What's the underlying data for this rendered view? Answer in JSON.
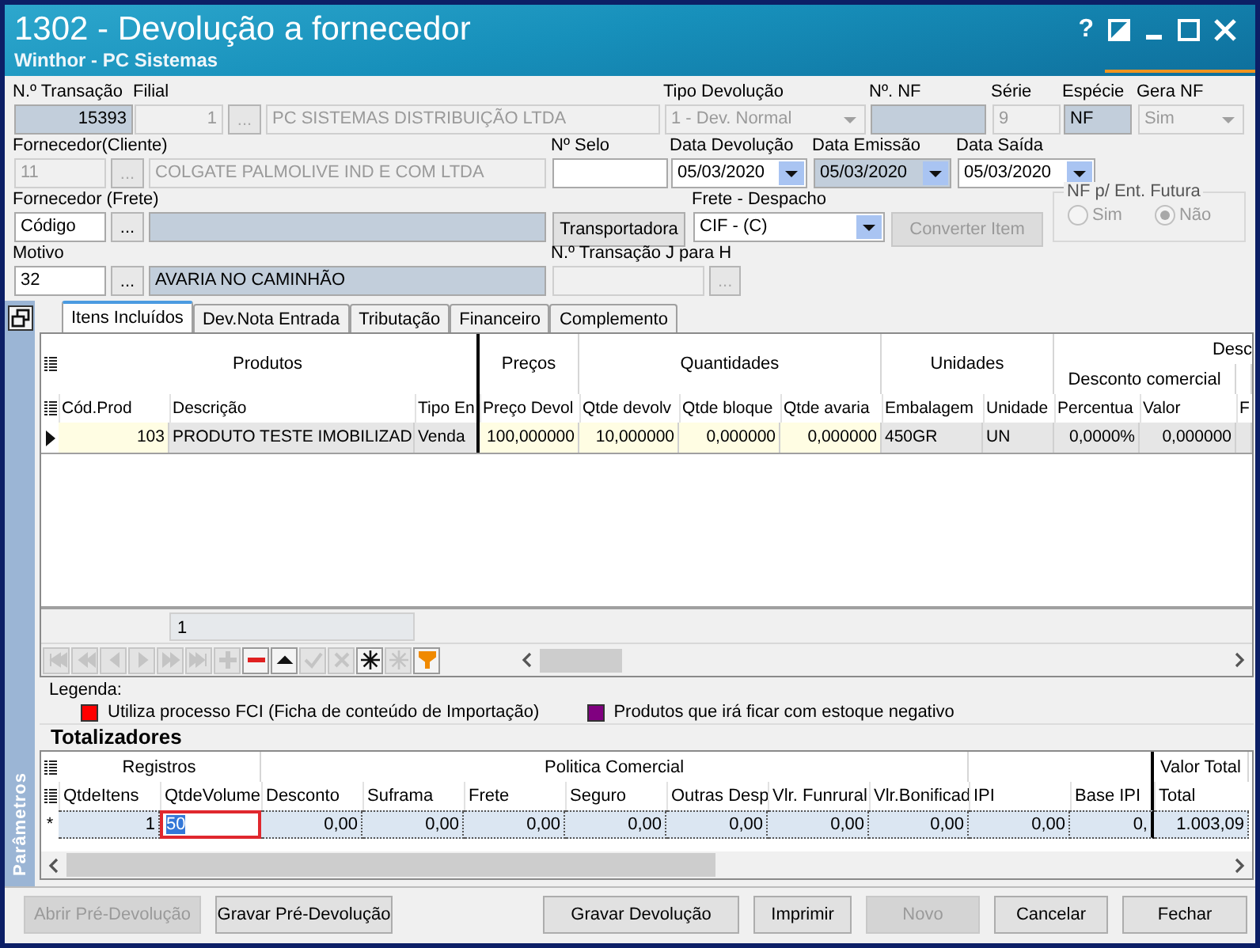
{
  "window": {
    "title": "1302 - Devolução a fornecedor",
    "subtitle": "Winthor - PC Sistemas",
    "help": "?"
  },
  "form": {
    "rows": [
      {
        "columns": [
          {
            "label": "N.º Transação",
            "controls": [
              {
                "kind": "number-field",
                "value": "15393",
                "readonly": true,
                "disabled": false
              }
            ]
          },
          {
            "label": "Filial",
            "controls": [
              {
                "kind": "number-field",
                "value": "1",
                "disabled": true
              },
              {
                "kind": "ellipsis",
                "label": "...",
                "disabled": true
              },
              {
                "kind": "field",
                "value": "PC SISTEMAS DISTRIBUIÇÃO LTDA",
                "disabled": true
              }
            ]
          },
          {
            "label": "Tipo Devolução",
            "controls": [
              {
                "kind": "combo",
                "value": "1 - Dev. Normal",
                "disabled": true
              }
            ]
          },
          {
            "label": "Nº. NF",
            "controls": [
              {
                "kind": "field",
                "readonly": true,
                "disabled": false
              }
            ]
          },
          {
            "label": "Série",
            "controls": [
              {
                "kind": "field",
                "value": "9",
                "disabled": true
              }
            ]
          },
          {
            "label": "Espécie",
            "controls": [
              {
                "kind": "field",
                "value": "NF",
                "readonly": true,
                "disabled": false
              }
            ]
          },
          {
            "label": "Gera NF",
            "controls": [
              {
                "kind": "combo",
                "value": "Sim",
                "disabled": true
              }
            ]
          }
        ]
      },
      {
        "columns": [
          {
            "label": "Fornecedor(Cliente)",
            "controls": [
              {
                "kind": "field",
                "value": "11",
                "disabled": true
              },
              {
                "kind": "ellipsis",
                "label": "...",
                "disabled": true
              },
              {
                "kind": "field",
                "value": "COLGATE PALMOLIVE IND E COM LTDA",
                "disabled": true
              }
            ]
          },
          {
            "label": "Nº Selo",
            "controls": [
              {
                "kind": "field",
                "readonly": false,
                "disabled": false
              }
            ]
          },
          {
            "label": "Data Devolução",
            "controls": [
              {
                "kind": "date",
                "value": "05/03/2020",
                "readonly": false,
                "disabled": false
              }
            ]
          },
          {
            "label": "Data Emissão",
            "controls": [
              {
                "kind": "date",
                "value": "05/03/2020",
                "readonly": true,
                "disabled": false
              }
            ]
          },
          {
            "label": "Data Saída",
            "controls": [
              {
                "kind": "date",
                "value": "05/03/2020",
                "readonly": false,
                "disabled": false
              }
            ]
          }
        ]
      },
      {
        "columns": [
          {
            "label": "Fornecedor (Frete)",
            "controls": [
              {
                "kind": "field",
                "value": "Código",
                "readonly": false,
                "disabled": false
              },
              {
                "kind": "ellipsis",
                "label": "...",
                "disabled": false
              },
              {
                "kind": "field",
                "readonly": true,
                "disabled": false
              }
            ]
          },
          {
            "controls": [
              {
                "kind": "button",
                "label": "Transportadora",
                "disabled": false
              }
            ]
          },
          {
            "label": "Frete - Despacho",
            "controls": [
              {
                "kind": "combo",
                "value": "CIF - (C)",
                "readonly": false,
                "disabled": false
              }
            ]
          },
          {
            "controls": [
              {
                "kind": "button",
                "label": "Converter Item",
                "disabled": true
              }
            ]
          },
          {
            "controls": [
              {
                "kind": "radio-group",
                "title": "NF p/ Ent. Futura",
                "disabled": true,
                "options": [
                  {
                    "label": "Sim",
                    "selected": false
                  },
                  {
                    "label": "Não",
                    "selected": true
                  }
                ]
              }
            ]
          }
        ]
      },
      {
        "columns": [
          {
            "label": "Motivo",
            "controls": [
              {
                "kind": "field",
                "value": "32",
                "readonly": false,
                "disabled": false
              },
              {
                "kind": "ellipsis",
                "label": "...",
                "disabled": false
              },
              {
                "kind": "field",
                "value": "AVARIA NO CAMINHÃO",
                "readonly": true,
                "disabled": false
              }
            ]
          },
          {
            "label": "N.º Transação J para H",
            "controls": [
              {
                "kind": "field",
                "disabled": true
              },
              {
                "kind": "ellipsis",
                "label": "...",
                "disabled": true
              }
            ]
          }
        ]
      }
    ]
  },
  "side_panel": {
    "title": "Parâmetros"
  },
  "tabs": [
    {
      "label": "Itens Incluídos",
      "selected": true
    },
    {
      "label": "Dev.Nota Entrada",
      "selected": false
    },
    {
      "label": "Tributação",
      "selected": false
    },
    {
      "label": "Financeiro",
      "selected": false
    },
    {
      "label": "Complemento",
      "selected": false
    }
  ],
  "items_grid": {
    "groups": [
      {
        "label": "Produtos",
        "columns": [
          "Cód.Prod",
          "Descrição",
          "Tipo En"
        ]
      },
      {
        "label": "Preços",
        "columns": [
          "Preço Devol"
        ]
      },
      {
        "label": "Quantidades",
        "columns": [
          "Qtde devolv",
          "Qtde bloque",
          "Qtde avaria"
        ]
      },
      {
        "label": "Unidades",
        "columns": [
          "Embalagem",
          "Unidade"
        ]
      },
      {
        "label": "Desc",
        "subgroups": [
          {
            "label": "Desconto comercial",
            "columns": [
              "Percentua",
              "Valor"
            ]
          },
          {
            "columns": [
              "F"
            ]
          }
        ]
      }
    ],
    "rows": [
      {
        "current": true,
        "cells": [
          "103",
          "PRODUTO TESTE IMOBILIZAD",
          "Venda",
          "100,000000",
          "10,000000",
          "0,000000",
          "0,000000",
          "450GR",
          "UN",
          "0,0000%",
          "0,000000"
        ]
      }
    ],
    "footer_total": "1"
  },
  "navigator": [
    {
      "kind": "first",
      "disabled": true
    },
    {
      "kind": "prior-page",
      "disabled": true
    },
    {
      "kind": "prior",
      "disabled": true
    },
    {
      "kind": "next",
      "disabled": true
    },
    {
      "kind": "next-page",
      "disabled": true
    },
    {
      "kind": "last",
      "disabled": true
    },
    {
      "kind": "insert",
      "disabled": true
    },
    {
      "kind": "delete",
      "disabled": false
    },
    {
      "kind": "up",
      "disabled": false
    },
    {
      "kind": "post",
      "disabled": true
    },
    {
      "kind": "cancel",
      "disabled": true
    },
    {
      "kind": "asterisk",
      "disabled": false
    },
    {
      "kind": "asterisk",
      "disabled": true
    },
    {
      "kind": "filter",
      "disabled": false
    }
  ],
  "legend": {
    "title": "Legenda:",
    "items": [
      {
        "label": "Utiliza processo FCI (Ficha de conteúdo de Importação)",
        "color": "#ff0000"
      },
      {
        "label": "Produtos que irá ficar com estoque negativo",
        "color": "#800080"
      }
    ]
  },
  "totals": {
    "title": "Totalizadores",
    "groups": [
      {
        "label": "Registros",
        "columns": [
          "QtdeItens",
          "QtdeVolume"
        ]
      },
      {
        "label": "Politica Comercial",
        "columns": [
          "Desconto",
          "Suframa",
          "Frete",
          "Seguro",
          "Outras Desp",
          "Vlr. Funrural",
          "Vlr.Bonificad"
        ]
      },
      {
        "columns": [
          "IPI",
          "Base IPI"
        ]
      },
      {
        "label": "Valor Total",
        "columns": [
          "Total"
        ]
      }
    ],
    "rows": [
      {
        "marker": "*",
        "cells": [
          {
            "value": "1",
            "editing": false
          },
          {
            "value": "50",
            "editing": true
          },
          {
            "value": "0,00",
            "editing": false
          },
          {
            "value": "0,00",
            "editing": false
          },
          {
            "value": "0,00",
            "editing": false
          },
          {
            "value": "0,00",
            "editing": false
          },
          {
            "value": "0,00",
            "editing": false
          },
          {
            "value": "0,00",
            "editing": false
          },
          {
            "value": "0,00",
            "editing": false
          },
          {
            "value": "0,00",
            "editing": false
          },
          {
            "value": "0,",
            "editing": false
          },
          {
            "value": "1.003,09",
            "editing": false
          }
        ]
      }
    ]
  },
  "buttons": [
    {
      "label": "Abrir Pré-Devolução",
      "disabled": true
    },
    {
      "label": "Gravar Pré-Devolução",
      "disabled": false
    },
    {
      "label": "Gravar Devolução",
      "disabled": false
    },
    {
      "label": "Imprimir",
      "disabled": false
    },
    {
      "label": "Novo",
      "disabled": true
    },
    {
      "label": "Cancelar",
      "disabled": false
    },
    {
      "label": "Fechar",
      "disabled": false
    }
  ]
}
